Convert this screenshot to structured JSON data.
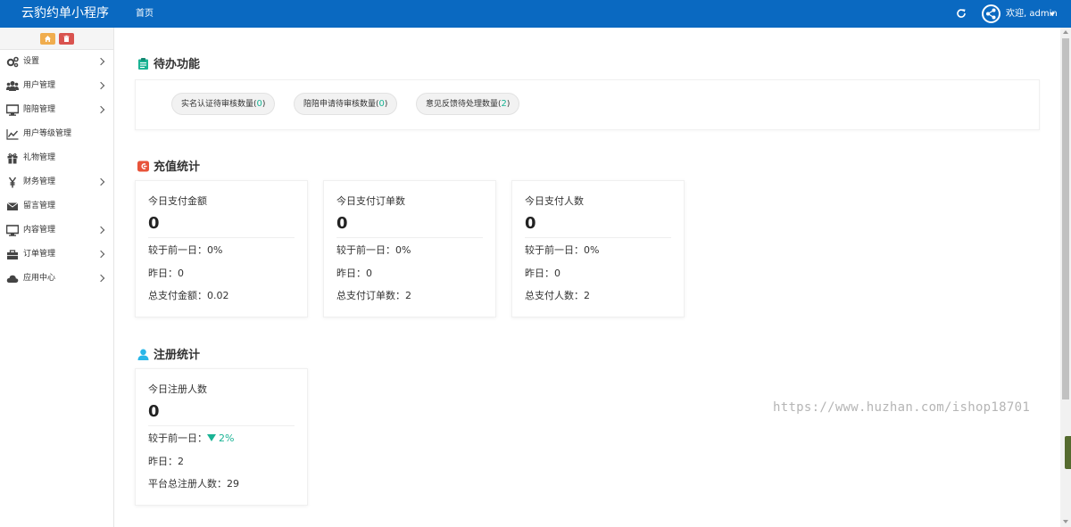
{
  "header": {
    "app_title": "云豹约单小程序",
    "nav_home": "首页",
    "welcome": "欢迎, admin"
  },
  "icons": {
    "refresh": "refresh-icon",
    "share": "share-icon",
    "user_menu": "caret-down-icon"
  },
  "sidebar": {
    "items": [
      {
        "label": "设置",
        "icon": "gears-icon",
        "expandable": true
      },
      {
        "label": "用户管理",
        "icon": "users-icon",
        "expandable": true
      },
      {
        "label": "陪陪管理",
        "icon": "monitor-icon",
        "expandable": true
      },
      {
        "label": "用户等级管理",
        "icon": "line-chart-icon",
        "expandable": false
      },
      {
        "label": "礼物管理",
        "icon": "gift-icon",
        "expandable": false
      },
      {
        "label": "财务管理",
        "icon": "yen-icon",
        "expandable": true
      },
      {
        "label": "留言管理",
        "icon": "envelope-icon",
        "expandable": false
      },
      {
        "label": "内容管理",
        "icon": "monitor-icon",
        "expandable": true
      },
      {
        "label": "订单管理",
        "icon": "briefcase-icon",
        "expandable": true
      },
      {
        "label": "应用中心",
        "icon": "cloud-icon",
        "expandable": true
      }
    ]
  },
  "todo": {
    "title": "待办功能",
    "items": [
      {
        "label": "实名认证待审核数量(",
        "count": "0",
        "suffix": ")"
      },
      {
        "label": "陪陪申请待审核数量(",
        "count": "0",
        "suffix": ")"
      },
      {
        "label": "意见反馈待处理数量(",
        "count": "2",
        "suffix": ")"
      }
    ]
  },
  "recharge": {
    "title": "充值统计",
    "cards": [
      {
        "title": "今日支付金额",
        "value": "0",
        "compare": "较于前一日：0%",
        "yesterday": "昨日：0",
        "total": "总支付金额：0.02"
      },
      {
        "title": "今日支付订单数",
        "value": "0",
        "compare": "较于前一日：0%",
        "yesterday": "昨日：0",
        "total": "总支付订单数：2"
      },
      {
        "title": "今日支付人数",
        "value": "0",
        "compare": "较于前一日：0%",
        "yesterday": "昨日：0",
        "total": "总支付人数：2"
      }
    ]
  },
  "register": {
    "title": "注册统计",
    "card": {
      "title": "今日注册人数",
      "value": "0",
      "compare_label": "较于前一日：",
      "compare_value": "2%",
      "yesterday": "昨日：2",
      "total": "平台总注册人数：29"
    }
  },
  "watermark": "https://www.huzhan.com/ishop18701",
  "colors": {
    "topbar": "#0a69c1",
    "accent_green": "#1ab394",
    "home_button": "#f0ad4e",
    "trash_button": "#d9534f"
  }
}
